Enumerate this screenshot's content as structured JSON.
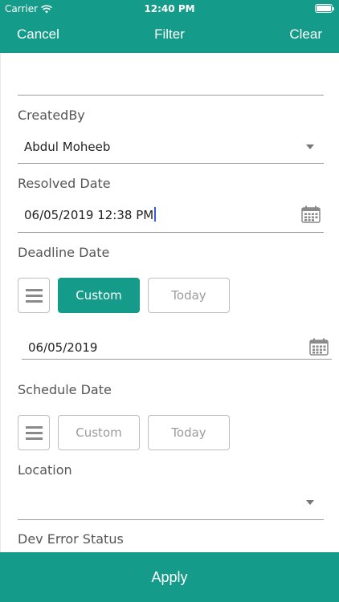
{
  "status_bar": {
    "carrier": "Carrier",
    "time": "12:40 PM"
  },
  "nav": {
    "cancel": "Cancel",
    "title": "Filter",
    "clear": "Clear"
  },
  "fields": {
    "created_by": {
      "label": "CreatedBy",
      "value": "Abdul Moheeb"
    },
    "resolved_date": {
      "label": "Resolved Date",
      "value": "06/05/2019 12:38 PM"
    },
    "deadline_date": {
      "label": "Deadline Date",
      "custom": "Custom",
      "today": "Today",
      "value": "06/05/2019"
    },
    "schedule_date": {
      "label": "Schedule Date",
      "custom": "Custom",
      "today": "Today"
    },
    "location": {
      "label": "Location",
      "value": ""
    },
    "dev_error_status": {
      "label": "Dev Error Status"
    }
  },
  "apply_label": "Apply",
  "colors": {
    "accent": "#149b8a"
  },
  "icons": [
    "wifi-icon",
    "battery-icon",
    "dropdown-arrow-icon",
    "calendar-icon",
    "menu-icon"
  ]
}
